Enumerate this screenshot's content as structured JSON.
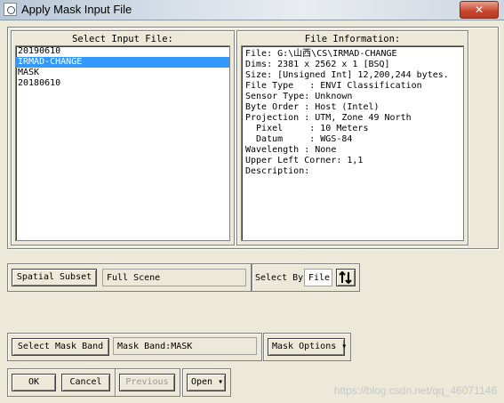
{
  "window": {
    "title": "Apply Mask Input File",
    "close_symbol": "✕"
  },
  "input_files": {
    "caption": "Select Input File:",
    "items": [
      "20190610",
      "IRMAD-CHANGE",
      "MASK",
      "20180610"
    ],
    "selected_index": 1
  },
  "file_info": {
    "caption": "File Information:",
    "lines": [
      "File: G:\\山西\\CS\\IRMAD-CHANGE",
      "Dims: 2381 x 2562 x 1 [BSQ]",
      "Size: [Unsigned Int] 12,200,244 bytes.",
      "File Type   : ENVI Classification",
      "Sensor Type: Unknown",
      "Byte Order : Host (Intel)",
      "Projection : UTM, Zone 49 North",
      "  Pixel     : 10 Meters",
      "  Datum     : WGS-84",
      "Wavelength : None",
      "Upper Left Corner: 1,1",
      "Description:"
    ]
  },
  "spatial": {
    "button": "Spatial Subset",
    "value": "Full Scene"
  },
  "select_by": {
    "label": "Select By",
    "value": "File",
    "sort_icon": "sort-icon"
  },
  "mask": {
    "button": "Select Mask Band",
    "value": "Mask Band:MASK",
    "options": "Mask Options"
  },
  "footer": {
    "ok": "OK",
    "cancel": "Cancel",
    "previous": "Previous",
    "open": "Open"
  },
  "watermark": "https://blog.csdn.net/qq_46071146"
}
